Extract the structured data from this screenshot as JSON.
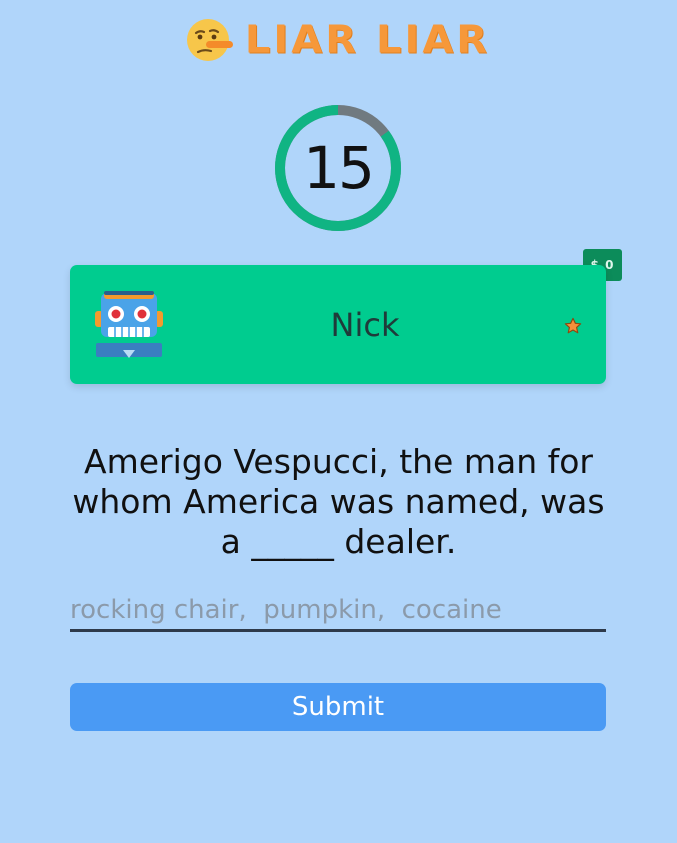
{
  "header": {
    "title": "LIAR LIAR",
    "icon": "lying-face-icon"
  },
  "timer": {
    "seconds_left": "15",
    "remaining_fraction": 0.85,
    "ring_color": "#10b483",
    "track_color": "#707a80"
  },
  "player": {
    "name": "Nick",
    "avatar": "robot-icon",
    "score": "$ 0",
    "marker": "star-icon",
    "card_color": "#00cc8f"
  },
  "question": {
    "text": "Amerigo Vespucci, the man for whom America was named, was a _____ dealer."
  },
  "answer": {
    "placeholder": "rocking chair,  pumpkin,  cocaine",
    "value": ""
  },
  "actions": {
    "submit_label": "Submit"
  }
}
